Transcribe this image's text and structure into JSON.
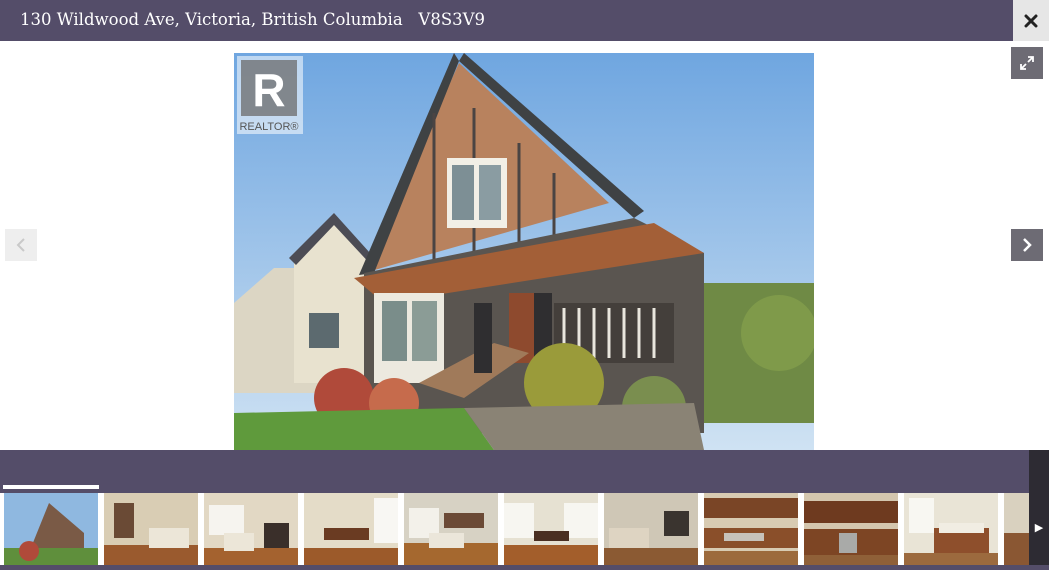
{
  "header": {
    "address": "130 Wildwood Ave, Victoria, British Columbia",
    "postal_code": "V8S3V9",
    "close_icon": "close-icon"
  },
  "viewer": {
    "watermark": "REALTOR®",
    "prev_icon": "chevron-left-icon",
    "next_icon": "chevron-right-icon",
    "fullscreen_icon": "expand-icon",
    "current_index": 1
  },
  "thumbnails": [
    {
      "name": "exterior-front"
    },
    {
      "name": "living-room"
    },
    {
      "name": "living-room-fireplace"
    },
    {
      "name": "dining-room"
    },
    {
      "name": "open-living-area"
    },
    {
      "name": "dining-area"
    },
    {
      "name": "family-room"
    },
    {
      "name": "kitchen"
    },
    {
      "name": "kitchen-cabinets"
    },
    {
      "name": "bedroom"
    }
  ],
  "strip": {
    "more_icon": "play-right-icon"
  },
  "colors": {
    "header_bg": "#544d69",
    "strip_bg": "#544d69",
    "nav_bg": "#6d6b74"
  }
}
